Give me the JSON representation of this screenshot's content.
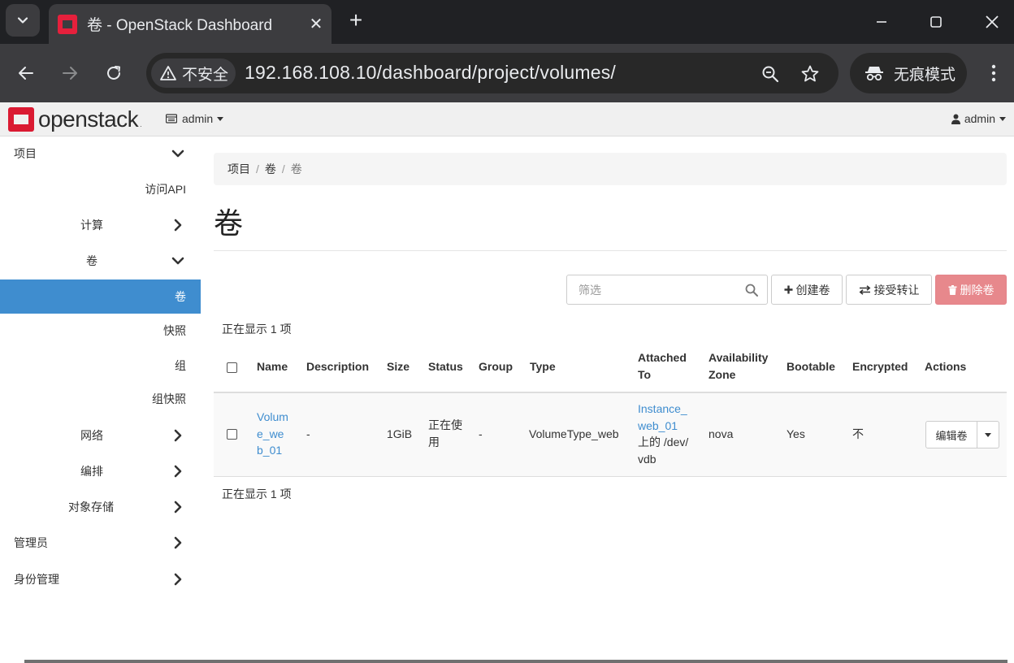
{
  "browser": {
    "tab_title": "卷 - OpenStack Dashboard",
    "security_label": "不安全",
    "url": "192.168.108.10/dashboard/project/volumes/",
    "incognito_label": "无痕模式"
  },
  "navbar": {
    "logo_text": "openstack",
    "logo_mark": ".",
    "project": "admin",
    "user": "admin"
  },
  "sidebar": {
    "items": [
      {
        "label": "项目",
        "chevron": "down"
      },
      {
        "label": "访问API"
      },
      {
        "label": "计算",
        "chevron": "right"
      },
      {
        "label": "卷",
        "chevron": "down"
      },
      {
        "label": "卷",
        "active": true
      },
      {
        "label": "快照"
      },
      {
        "label": "组"
      },
      {
        "label": "组快照"
      },
      {
        "label": "网络",
        "chevron": "right"
      },
      {
        "label": "编排",
        "chevron": "right"
      },
      {
        "label": "对象存储",
        "chevron": "right"
      },
      {
        "label": "管理员",
        "chevron": "right"
      },
      {
        "label": "身份管理",
        "chevron": "right"
      }
    ]
  },
  "breadcrumb": [
    "项目",
    "卷",
    "卷"
  ],
  "page_title": "卷",
  "actions": {
    "filter_placeholder": "筛选",
    "create": "创建卷",
    "accept_transfer": "接受转让",
    "delete": "删除卷"
  },
  "count_text": "正在显示 1 项",
  "table": {
    "headers": {
      "name": "Name",
      "description": "Description",
      "size": "Size",
      "status": "Status",
      "group": "Group",
      "type": "Type",
      "attached_1": "Attached",
      "attached_2": "To",
      "az_1": "Availability",
      "az_2": "Zone",
      "bootable": "Bootable",
      "encrypted": "Encrypted",
      "actions": "Actions"
    },
    "rows": [
      {
        "name": [
          "Volum",
          "e_we",
          "b_01"
        ],
        "description": "-",
        "size": "1GiB",
        "status": [
          "正在使",
          "用"
        ],
        "group": "-",
        "type": "VolumeType_web",
        "attached_link": [
          "Instance_",
          "web_01"
        ],
        "attached_rest": [
          "上的 /dev/",
          "vdb"
        ],
        "az": "nova",
        "bootable": "Yes",
        "encrypted": "不",
        "action": "编辑卷"
      }
    ]
  }
}
